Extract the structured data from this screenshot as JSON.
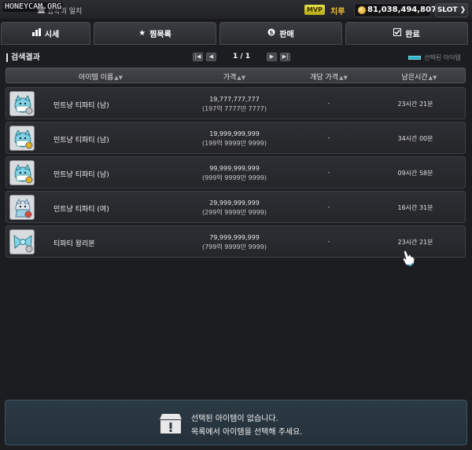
{
  "watermark": "HONEYCAM.ORG",
  "topbar": {
    "exact_match_label": "정확히 일치",
    "mvp_badge": "MVP",
    "server_name": "치루",
    "meso": "81,038,494,807",
    "slot_label": "SLOT"
  },
  "tabs": [
    {
      "label": "시세",
      "icon": "bar-chart-icon"
    },
    {
      "label": "찜목록",
      "icon": "star-icon"
    },
    {
      "label": "판매",
      "icon": "sell-icon"
    },
    {
      "label": "완료",
      "icon": "check-icon"
    }
  ],
  "results": {
    "title": "검색결과",
    "pager": {
      "text": "1 / 1",
      "first": "|◀",
      "prev": "◀",
      "next": "▶",
      "last": "▶|"
    },
    "selected_legend": "선택된 아이템"
  },
  "table": {
    "headers": {
      "name": "아이템 이름",
      "price": "가격",
      "unit_price": "개당 가격",
      "time_left": "남은시간"
    },
    "rows": [
      {
        "name": "민트냥 티파티 (남)",
        "price": "19,777,777,777",
        "price_kr": "(197억 7777만 7777)",
        "unit_price": "-",
        "time_left": "23시간 21분",
        "icon": "cat-tea-party-male-icon"
      },
      {
        "name": "민트냥 티파티 (남)",
        "price": "19,999,999,999",
        "price_kr": "(199억 9999만 9999)",
        "unit_price": "-",
        "time_left": "34시간 00분",
        "icon": "cat-tea-party-male-icon"
      },
      {
        "name": "민트냥 티파티 (남)",
        "price": "99,999,999,999",
        "price_kr": "(999억 9999만 9999)",
        "unit_price": "-",
        "time_left": "09시간 58분",
        "icon": "cat-tea-party-male-icon"
      },
      {
        "name": "민트냥 티파티 (여)",
        "price": "29,999,999,999",
        "price_kr": "(299억 9999만 9999)",
        "unit_price": "-",
        "time_left": "16시간 31분",
        "icon": "cat-tea-party-female-icon"
      },
      {
        "name": "티파티 왕리본",
        "price": "79,999,999,999",
        "price_kr": "(799억 9999만 9999)",
        "unit_price": "-",
        "time_left": "23시간 21분",
        "icon": "ribbon-icon"
      }
    ]
  },
  "empty_selection": {
    "line1": "선택된 아이템이 없습니다.",
    "line2": "목록에서 아이템을 선택해 주세요."
  },
  "colors": {
    "background": "#1c1d20",
    "accent_cyan": "#2ab3c4",
    "meso_gold": "#f2c12e",
    "mvp_yellow": "#e7e24a"
  }
}
